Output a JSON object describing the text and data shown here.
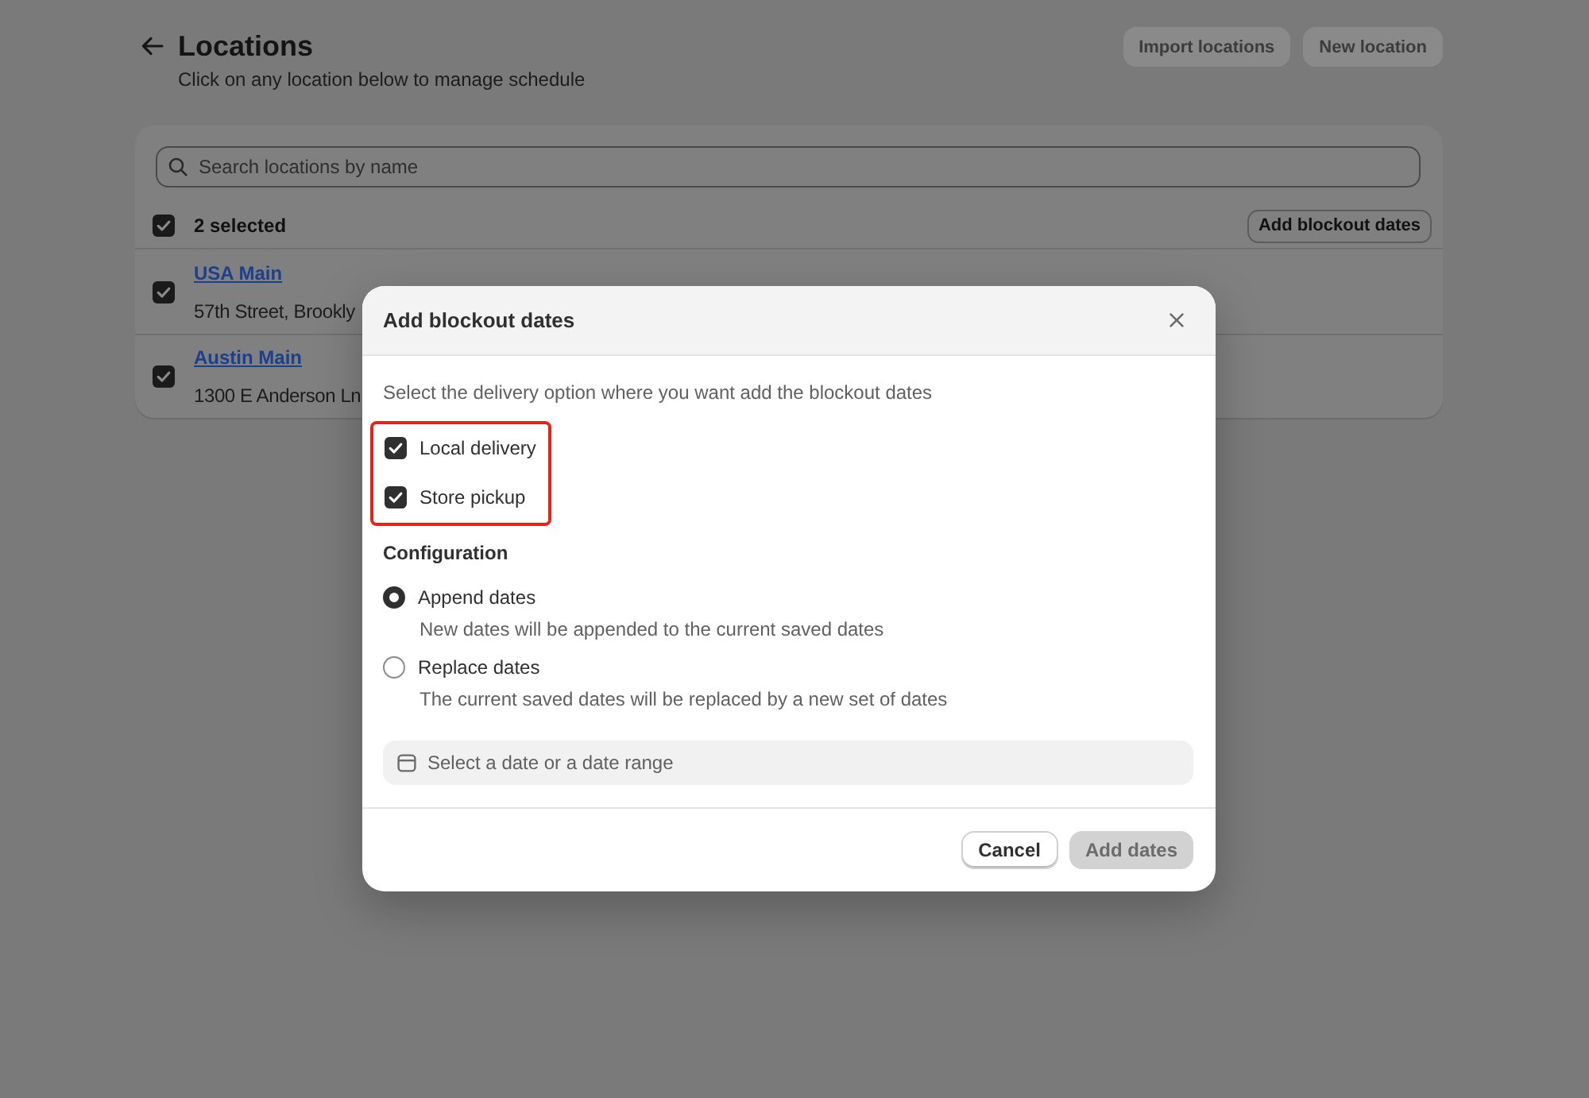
{
  "page": {
    "title": "Locations",
    "subtitle": "Click on any location below to manage schedule",
    "actions": [
      {
        "label": "Import locations",
        "disabled": true
      },
      {
        "label": "New location",
        "disabled": true
      }
    ]
  },
  "locations_card": {
    "search": {
      "placeholder": "Search locations by name"
    },
    "bulk_bar": {
      "checked": true,
      "label": "2 selected",
      "action": "Add blockout dates"
    },
    "rows": [
      {
        "name": "USA Main",
        "address": "57th Street, Brookly",
        "selected": true
      },
      {
        "name": "Austin Main",
        "address": "1300 E Anderson Ln",
        "selected": true
      }
    ]
  },
  "modal": {
    "title": "Add blockout dates",
    "prompt": "Select the delivery option where you want add the blockout dates",
    "delivery": {
      "highlighted": true,
      "options": [
        {
          "label": "Local delivery",
          "checked": true
        },
        {
          "label": "Store pickup",
          "checked": true
        }
      ]
    },
    "configuration": {
      "heading": "Configuration",
      "options": [
        {
          "label": "Append dates",
          "description": "New dates will be appended to the current saved dates",
          "selected": true
        },
        {
          "label": "Replace dates",
          "description": "The current saved dates will be replaced by a new set of dates",
          "selected": false
        }
      ]
    },
    "date_field": {
      "placeholder": "Select a date or a date range"
    },
    "buttons": [
      {
        "label": "Cancel",
        "kind": "secondary",
        "disabled": false
      },
      {
        "label": "Add dates",
        "kind": "primary",
        "disabled": true
      }
    ]
  }
}
